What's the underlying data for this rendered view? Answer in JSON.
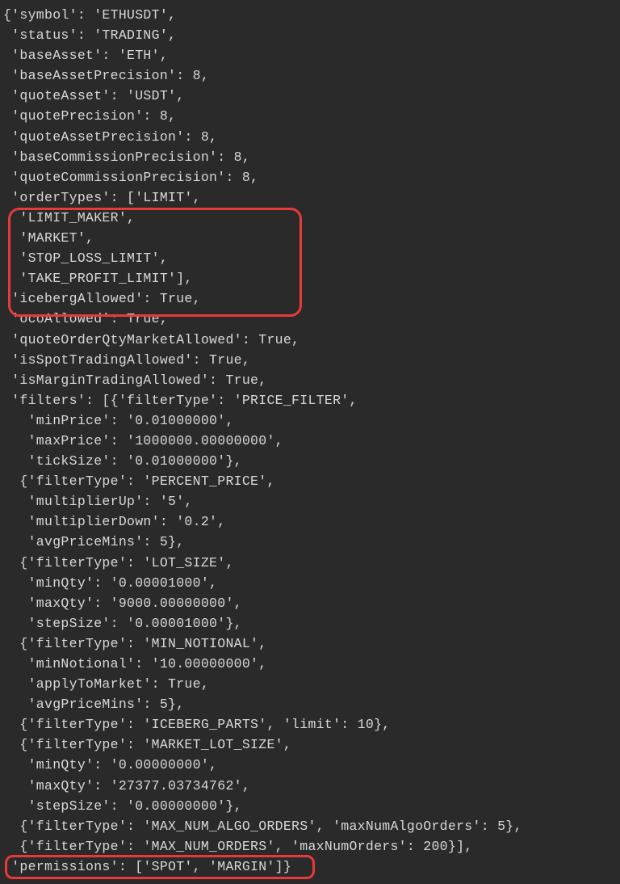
{
  "lines": [
    "{'symbol': 'ETHUSDT',",
    " 'status': 'TRADING',",
    " 'baseAsset': 'ETH',",
    " 'baseAssetPrecision': 8,",
    " 'quoteAsset': 'USDT',",
    " 'quotePrecision': 8,",
    " 'quoteAssetPrecision': 8,",
    " 'baseCommissionPrecision': 8,",
    " 'quoteCommissionPrecision': 8,",
    " 'orderTypes': ['LIMIT',",
    "  'LIMIT_MAKER',",
    "  'MARKET',",
    "  'STOP_LOSS_LIMIT',",
    "  'TAKE_PROFIT_LIMIT'],",
    " 'icebergAllowed': True,",
    " 'ocoAllowed': True,",
    " 'quoteOrderQtyMarketAllowed': True,",
    " 'isSpotTradingAllowed': True,",
    " 'isMarginTradingAllowed': True,",
    " 'filters': [{'filterType': 'PRICE_FILTER',",
    "   'minPrice': '0.01000000',",
    "   'maxPrice': '1000000.00000000',",
    "   'tickSize': '0.01000000'},",
    "  {'filterType': 'PERCENT_PRICE',",
    "   'multiplierUp': '5',",
    "   'multiplierDown': '0.2',",
    "   'avgPriceMins': 5},",
    "  {'filterType': 'LOT_SIZE',",
    "   'minQty': '0.00001000',",
    "   'maxQty': '9000.00000000',",
    "   'stepSize': '0.00001000'},",
    "  {'filterType': 'MIN_NOTIONAL',",
    "   'minNotional': '10.00000000',",
    "   'applyToMarket': True,",
    "   'avgPriceMins': 5},",
    "  {'filterType': 'ICEBERG_PARTS', 'limit': 10},",
    "  {'filterType': 'MARKET_LOT_SIZE',",
    "   'minQty': '0.00000000',",
    "   'maxQty': '27377.03734762',",
    "   'stepSize': '0.00000000'},",
    "  {'filterType': 'MAX_NUM_ALGO_ORDERS', 'maxNumAlgoOrders': 5},",
    "  {'filterType': 'MAX_NUM_ORDERS', 'maxNumOrders': 200}],",
    " 'permissions': ['SPOT', 'MARGIN']}"
  ],
  "parsed": {
    "symbol": "ETHUSDT",
    "status": "TRADING",
    "baseAsset": "ETH",
    "baseAssetPrecision": 8,
    "quoteAsset": "USDT",
    "quotePrecision": 8,
    "quoteAssetPrecision": 8,
    "baseCommissionPrecision": 8,
    "quoteCommissionPrecision": 8,
    "orderTypes": [
      "LIMIT",
      "LIMIT_MAKER",
      "MARKET",
      "STOP_LOSS_LIMIT",
      "TAKE_PROFIT_LIMIT"
    ],
    "icebergAllowed": true,
    "ocoAllowed": true,
    "quoteOrderQtyMarketAllowed": true,
    "isSpotTradingAllowed": true,
    "isMarginTradingAllowed": true,
    "filters": [
      {
        "filterType": "PRICE_FILTER",
        "minPrice": "0.01000000",
        "maxPrice": "1000000.00000000",
        "tickSize": "0.01000000"
      },
      {
        "filterType": "PERCENT_PRICE",
        "multiplierUp": "5",
        "multiplierDown": "0.2",
        "avgPriceMins": 5
      },
      {
        "filterType": "LOT_SIZE",
        "minQty": "0.00001000",
        "maxQty": "9000.00000000",
        "stepSize": "0.00001000"
      },
      {
        "filterType": "MIN_NOTIONAL",
        "minNotional": "10.00000000",
        "applyToMarket": true,
        "avgPriceMins": 5
      },
      {
        "filterType": "ICEBERG_PARTS",
        "limit": 10
      },
      {
        "filterType": "MARKET_LOT_SIZE",
        "minQty": "0.00000000",
        "maxQty": "27377.03734762",
        "stepSize": "0.00000000"
      },
      {
        "filterType": "MAX_NUM_ALGO_ORDERS",
        "maxNumAlgoOrders": 5
      },
      {
        "filterType": "MAX_NUM_ORDERS",
        "maxNumOrders": 200
      }
    ],
    "permissions": [
      "SPOT",
      "MARGIN"
    ]
  },
  "highlights": [
    {
      "name": "highlight-order-types"
    },
    {
      "name": "highlight-permissions"
    }
  ]
}
